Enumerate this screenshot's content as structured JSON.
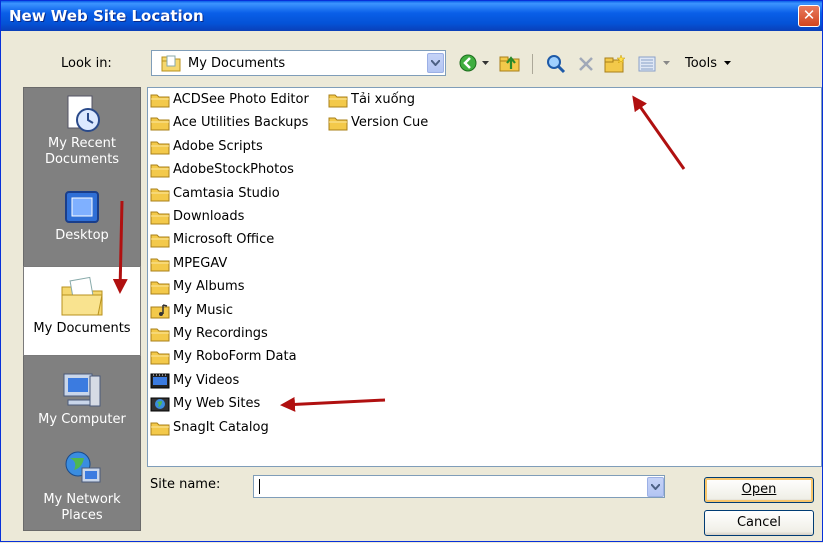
{
  "window": {
    "title": "New Web Site Location",
    "close_label": "✕"
  },
  "lookin": {
    "label": "Look in:",
    "value": "My Documents"
  },
  "toolbar": {
    "tools_label": "Tools"
  },
  "places": [
    {
      "label": "My Recent Documents"
    },
    {
      "label": "Desktop"
    },
    {
      "label": "My Documents"
    },
    {
      "label": "My Computer"
    },
    {
      "label": "My Network Places"
    }
  ],
  "files": [
    "ACDSee Photo Editor",
    "Ace Utilities Backups",
    "Adobe Scripts",
    "AdobeStockPhotos",
    "Camtasia Studio",
    "Downloads",
    "Microsoft Office",
    "MPEGAV",
    "My Albums",
    "My Music",
    "My Recordings",
    "My RoboForm Data",
    "My Videos",
    "My Web Sites",
    "SnagIt Catalog",
    "Tải xuống",
    "Version Cue"
  ],
  "site_name": {
    "label": "Site name:",
    "value": ""
  },
  "buttons": {
    "open": "Open",
    "cancel": "Cancel"
  },
  "colors": {
    "title_bar": "#0a5fe8",
    "places_bg": "#808080",
    "annotation_arrow": "#b01010"
  }
}
